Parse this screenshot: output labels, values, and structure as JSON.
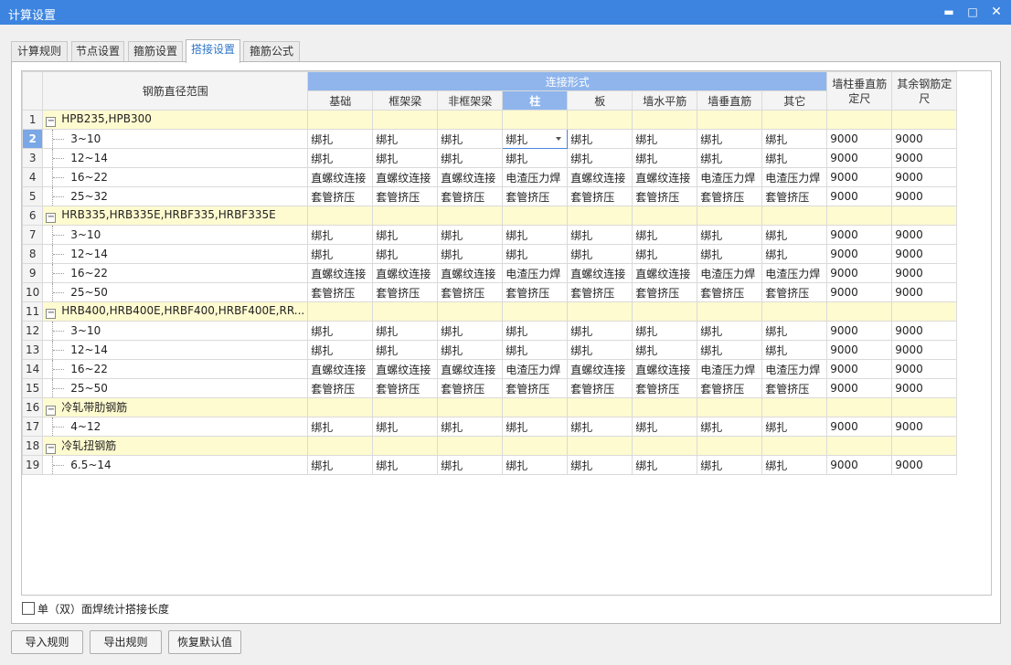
{
  "window": {
    "title": "计算设置",
    "minimize_glyph": "▬",
    "maximize_glyph": "□",
    "close_glyph": "✕"
  },
  "tabs": [
    {
      "label": "计算规则",
      "active": false
    },
    {
      "label": "节点设置",
      "active": false
    },
    {
      "label": "箍筋设置",
      "active": false
    },
    {
      "label": "搭接设置",
      "active": true
    },
    {
      "label": "箍筋公式",
      "active": false
    }
  ],
  "grid": {
    "header": {
      "range_label": "钢筋直径范围",
      "connection_group_label": "连接形式",
      "columns": [
        "基础",
        "框架梁",
        "非框架梁",
        "柱",
        "板",
        "墙水平筋",
        "墙垂直筋",
        "其它"
      ],
      "active_column": "柱",
      "col_wall_label_1": "墙柱垂直筋",
      "col_wall_label_2": "定尺",
      "col_other_label_1": "其余钢筋定",
      "col_other_label_2": "尺"
    },
    "rows": [
      {
        "num": "1",
        "group": true,
        "name": "HPB235,HPB300",
        "expander": "−"
      },
      {
        "num": "2",
        "name": "3~10",
        "conn": [
          "绑扎",
          "绑扎",
          "绑扎",
          "绑扎",
          "绑扎",
          "绑扎",
          "绑扎",
          "绑扎"
        ],
        "wall": "9000",
        "other": "9000",
        "current": true
      },
      {
        "num": "3",
        "name": "12~14",
        "conn": [
          "绑扎",
          "绑扎",
          "绑扎",
          "绑扎",
          "绑扎",
          "绑扎",
          "绑扎",
          "绑扎"
        ],
        "wall": "9000",
        "other": "9000"
      },
      {
        "num": "4",
        "name": "16~22",
        "conn": [
          "直螺纹连接",
          "直螺纹连接",
          "直螺纹连接",
          "电渣压力焊",
          "直螺纹连接",
          "直螺纹连接",
          "电渣压力焊",
          "电渣压力焊"
        ],
        "wall": "9000",
        "other": "9000"
      },
      {
        "num": "5",
        "name": "25~32",
        "conn": [
          "套管挤压",
          "套管挤压",
          "套管挤压",
          "套管挤压",
          "套管挤压",
          "套管挤压",
          "套管挤压",
          "套管挤压"
        ],
        "wall": "9000",
        "other": "9000"
      },
      {
        "num": "6",
        "group": true,
        "name": "HRB335,HRB335E,HRBF335,HRBF335E",
        "expander": "−"
      },
      {
        "num": "7",
        "name": "3~10",
        "conn": [
          "绑扎",
          "绑扎",
          "绑扎",
          "绑扎",
          "绑扎",
          "绑扎",
          "绑扎",
          "绑扎"
        ],
        "wall": "9000",
        "other": "9000"
      },
      {
        "num": "8",
        "name": "12~14",
        "conn": [
          "绑扎",
          "绑扎",
          "绑扎",
          "绑扎",
          "绑扎",
          "绑扎",
          "绑扎",
          "绑扎"
        ],
        "wall": "9000",
        "other": "9000"
      },
      {
        "num": "9",
        "name": "16~22",
        "conn": [
          "直螺纹连接",
          "直螺纹连接",
          "直螺纹连接",
          "电渣压力焊",
          "直螺纹连接",
          "直螺纹连接",
          "电渣压力焊",
          "电渣压力焊"
        ],
        "wall": "9000",
        "other": "9000"
      },
      {
        "num": "10",
        "name": "25~50",
        "conn": [
          "套管挤压",
          "套管挤压",
          "套管挤压",
          "套管挤压",
          "套管挤压",
          "套管挤压",
          "套管挤压",
          "套管挤压"
        ],
        "wall": "9000",
        "other": "9000"
      },
      {
        "num": "11",
        "group": true,
        "name": "HRB400,HRB400E,HRBF400,HRBF400E,RR...",
        "expander": "−"
      },
      {
        "num": "12",
        "name": "3~10",
        "conn": [
          "绑扎",
          "绑扎",
          "绑扎",
          "绑扎",
          "绑扎",
          "绑扎",
          "绑扎",
          "绑扎"
        ],
        "wall": "9000",
        "other": "9000"
      },
      {
        "num": "13",
        "name": "12~14",
        "conn": [
          "绑扎",
          "绑扎",
          "绑扎",
          "绑扎",
          "绑扎",
          "绑扎",
          "绑扎",
          "绑扎"
        ],
        "wall": "9000",
        "other": "9000"
      },
      {
        "num": "14",
        "name": "16~22",
        "conn": [
          "直螺纹连接",
          "直螺纹连接",
          "直螺纹连接",
          "电渣压力焊",
          "直螺纹连接",
          "直螺纹连接",
          "电渣压力焊",
          "电渣压力焊"
        ],
        "wall": "9000",
        "other": "9000"
      },
      {
        "num": "15",
        "name": "25~50",
        "conn": [
          "套管挤压",
          "套管挤压",
          "套管挤压",
          "套管挤压",
          "套管挤压",
          "套管挤压",
          "套管挤压",
          "套管挤压"
        ],
        "wall": "9000",
        "other": "9000"
      },
      {
        "num": "16",
        "group": true,
        "name": "冷轧带肋钢筋",
        "expander": "−"
      },
      {
        "num": "17",
        "name": "4~12",
        "conn": [
          "绑扎",
          "绑扎",
          "绑扎",
          "绑扎",
          "绑扎",
          "绑扎",
          "绑扎",
          "绑扎"
        ],
        "wall": "9000",
        "other": "9000"
      },
      {
        "num": "18",
        "group": true,
        "name": "冷轧扭钢筋",
        "expander": "−"
      },
      {
        "num": "19",
        "name": "6.5~14",
        "conn": [
          "绑扎",
          "绑扎",
          "绑扎",
          "绑扎",
          "绑扎",
          "绑扎",
          "绑扎",
          "绑扎"
        ],
        "wall": "9000",
        "other": "9000"
      }
    ]
  },
  "checkbox": {
    "label": "单（双）面焊统计搭接长度",
    "checked": false
  },
  "buttons": {
    "import": "导入规则",
    "export": "导出规则",
    "restore": "恢复默认值"
  },
  "colors": {
    "titlebar": "#3c84e0",
    "header_active": "#8fb5ec",
    "group_row": "#fffbd0",
    "active_tab_text": "#2f76c8"
  }
}
